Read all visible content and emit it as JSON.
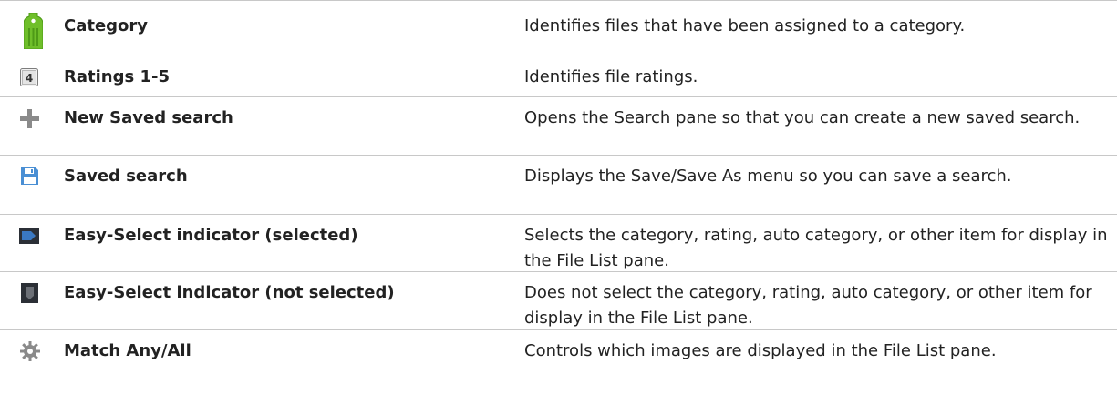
{
  "rows": [
    {
      "icon": "category-tag-icon",
      "name": "Category",
      "description": "Identifies files that have been assigned to a category."
    },
    {
      "icon": "rating-box-icon",
      "icon_text": "4",
      "name": "Ratings 1-5",
      "description": "Identifies file ratings."
    },
    {
      "icon": "plus-icon",
      "name": "New Saved search",
      "description": "Opens the Search pane so that you can create a new saved search."
    },
    {
      "icon": "floppy-disk-icon",
      "name": "Saved search",
      "description": "Displays the Save/Save As menu so you can save a search."
    },
    {
      "icon": "easy-select-selected-icon",
      "name": "Easy-Select indicator (selected)",
      "description": "Selects the category, rating, auto category, or other item for display in the File List pane."
    },
    {
      "icon": "easy-select-not-selected-icon",
      "name": "Easy-Select indicator (not selected)",
      "description": "Does not select the category, rating, auto category, or other item for display in the File List pane."
    },
    {
      "icon": "gear-icon",
      "name": "Match Any/All",
      "description": "Controls which images are displayed in the File List pane."
    }
  ],
  "colors": {
    "tag_green": "#6fbf2a",
    "tag_green_dark": "#4e9a17",
    "rule": "#c8c8c8",
    "floppy_blue": "#4a8fd4",
    "easy_select_dark": "#2b2f36",
    "easy_select_blue": "#3a78c2",
    "icon_gray": "#8a8a8a"
  }
}
